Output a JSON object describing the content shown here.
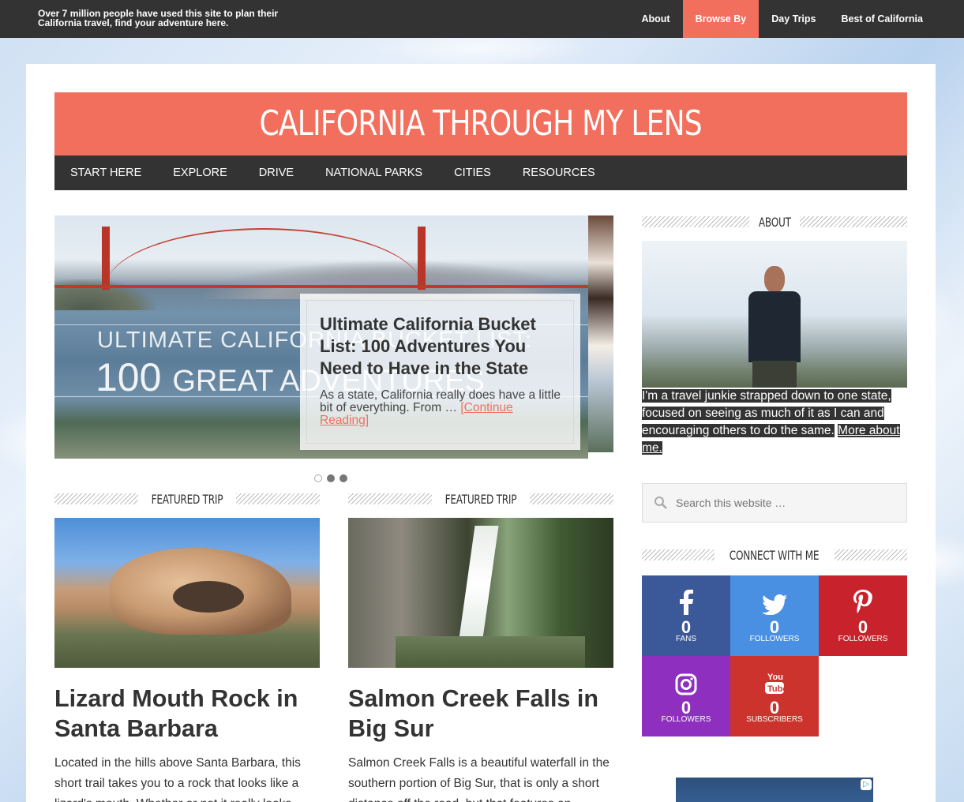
{
  "topbar": {
    "tagline": "Over 7 million people have used this site to plan their California travel, find your adventure here.",
    "nav": [
      "About",
      "Browse By",
      "Day Trips",
      "Best of California"
    ],
    "active": "Browse By"
  },
  "site": {
    "title": "CALIFORNIA THROUGH MY LENS",
    "nav": [
      "START HERE",
      "EXPLORE",
      "DRIVE",
      "NATIONAL PARKS",
      "CITIES",
      "RESOURCES"
    ]
  },
  "slider": {
    "image_line1": "ULTIMATE CALIFORNIA BUCKET LIST:",
    "image_line2_num": "100",
    "image_line2_text": "GREAT ADVENTURES",
    "title": "Ultimate California Bucket List: 100 Adventures You Need to Have in the State",
    "excerpt": "As a state, California really does have a little bit of everything. From …",
    "more_link": "[Continue Reading]",
    "pages": 3,
    "current_page": 3
  },
  "featured": [
    {
      "heading": "FEATURED TRIP",
      "title": "Lizard Mouth Rock in Santa Barbara",
      "excerpt": "Located in the hills above Santa Barbara, this short trail takes you to a rock that looks like a lizard's mouth. Whether or not it really looks"
    },
    {
      "heading": "FEATURED TRIP",
      "title": "Salmon Creek Falls in Big Sur",
      "excerpt": "Salmon Creek Falls is a beautiful waterfall in the southern portion of Big Sur, that is only a short distance off the road, but that features an"
    }
  ],
  "sidebar": {
    "about_heading": "ABOUT",
    "about_text": "I'm a travel junkie strapped down to one state, focused on seeing as much of it as I can and encouraging others to do the same.",
    "about_link": "More about me.",
    "search_placeholder": "Search this website …",
    "connect_heading": "CONNECT WITH ME",
    "social": [
      {
        "network": "facebook",
        "icon": "facebook-icon",
        "count": "0",
        "label": "FANS",
        "color": "#3b5998"
      },
      {
        "network": "twitter",
        "icon": "twitter-icon",
        "count": "0",
        "label": "FOLLOWERS",
        "color": "#4a90e2"
      },
      {
        "network": "pinterest",
        "icon": "pinterest-icon",
        "count": "0",
        "label": "FOLLOWERS",
        "color": "#c8232c"
      },
      {
        "network": "instagram",
        "icon": "instagram-icon",
        "count": "0",
        "label": "FOLLOWERS",
        "color": "#8e2fc0"
      },
      {
        "network": "youtube",
        "icon": "youtube-icon",
        "count": "0",
        "label": "SUBSCRIBERS",
        "color": "#cd332d"
      }
    ]
  },
  "colors": {
    "accent": "#f26f5e",
    "dark": "#333333"
  }
}
